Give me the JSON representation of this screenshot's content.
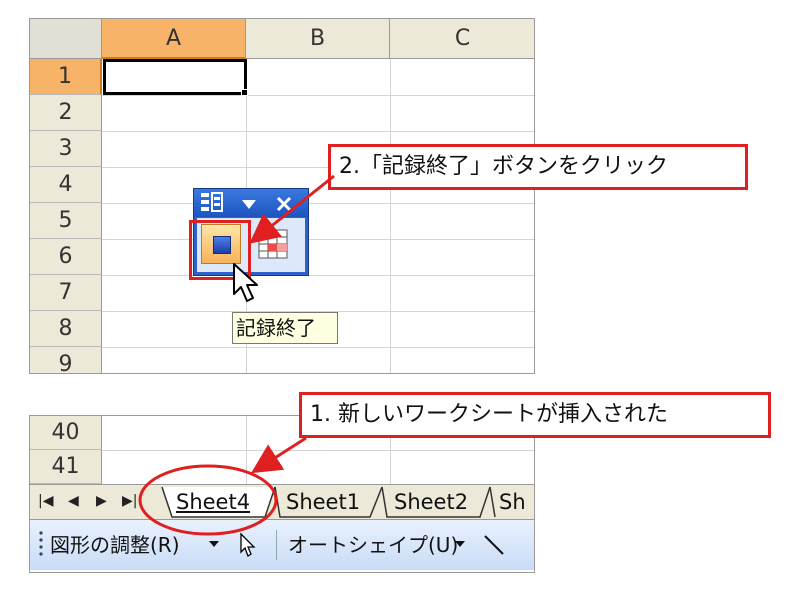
{
  "spreadsheet_top": {
    "columns": [
      "A",
      "B",
      "C"
    ],
    "rows": [
      "1",
      "2",
      "3",
      "4",
      "5",
      "6",
      "7",
      "8",
      "9"
    ]
  },
  "macro_toolbar": {
    "tooltip": "記録終了"
  },
  "callout_stop": "2.「記録終了」ボタンをクリック",
  "spreadsheet_bottom": {
    "rows": [
      "40",
      "41"
    ],
    "nav": [
      "|◀",
      "◀",
      "▶",
      "▶|"
    ],
    "tabs": [
      "Sheet4",
      "Sheet1",
      "Sheet2",
      "Sh"
    ]
  },
  "callout_sheet": "1. 新しいワークシートが挿入された",
  "drawing_toolbar": {
    "adjust_label": "図形の調整(R)",
    "autoshape_label": "オートシェイプ(U)"
  },
  "colors": {
    "annotation_red": "#e02020",
    "active_header": "#f7b367",
    "toolbar_blue": "#2d63c8"
  }
}
